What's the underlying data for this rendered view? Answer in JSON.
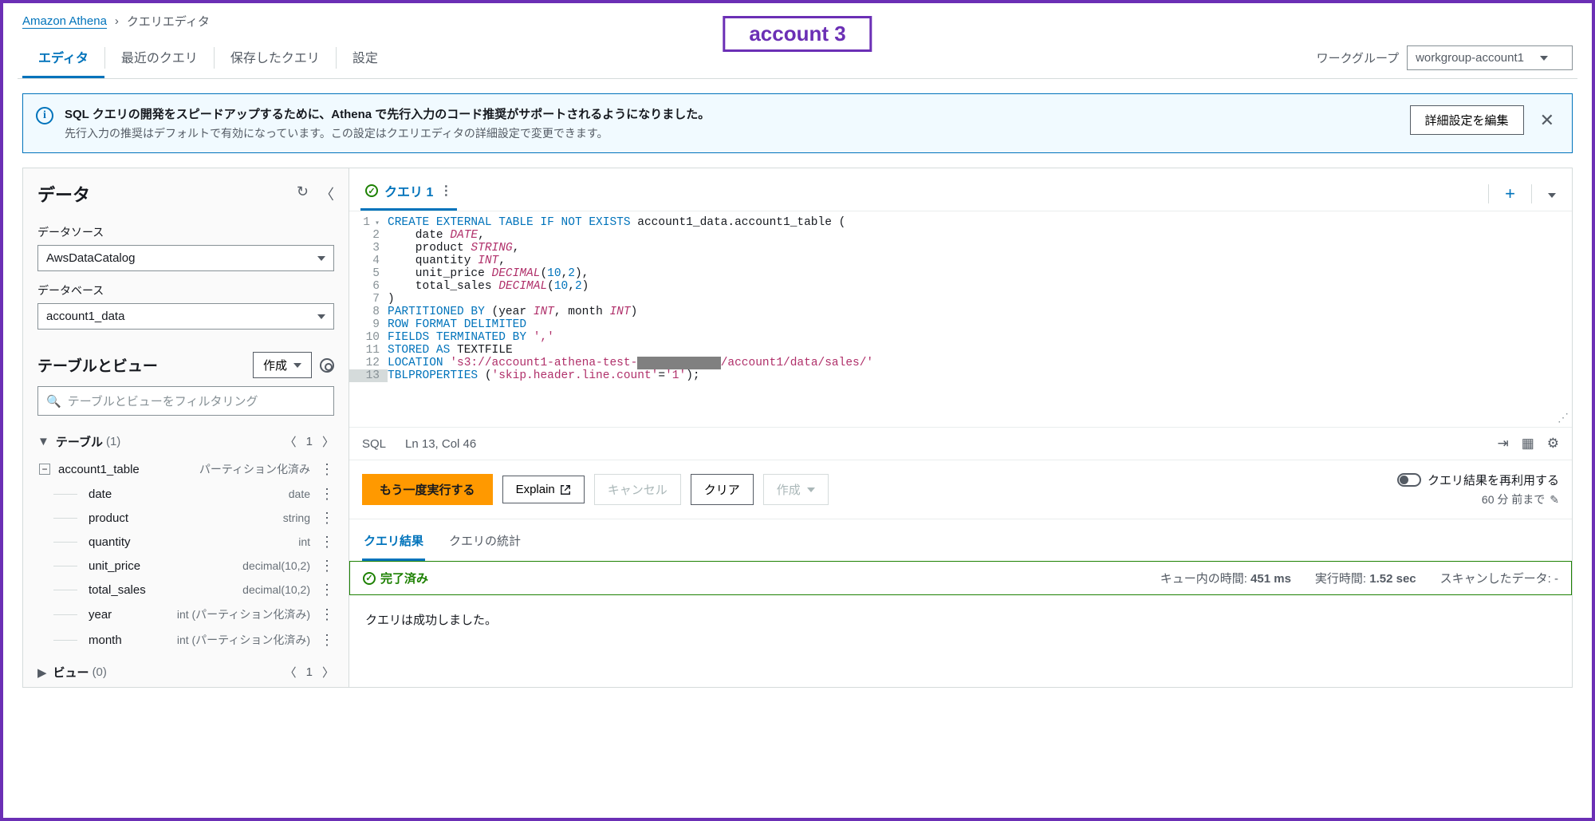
{
  "breadcrumb": {
    "service": "Amazon Athena",
    "page": "クエリエディタ"
  },
  "account_badge": "account 3",
  "tabs": {
    "editor": "エディタ",
    "recent": "最近のクエリ",
    "saved": "保存したクエリ",
    "settings": "設定"
  },
  "workgroup": {
    "label": "ワークグループ",
    "value": "workgroup-account1"
  },
  "banner": {
    "line1": "SQL クエリの開発をスピードアップするために、Athena で先行入力のコード推奨がサポートされるようになりました。",
    "line2": "先行入力の推奨はデフォルトで有効になっています。この設定はクエリエディタの詳細設定で変更できます。",
    "action": "詳細設定を編集"
  },
  "sidebar": {
    "title": "データ",
    "datasource_label": "データソース",
    "datasource_value": "AwsDataCatalog",
    "database_label": "データベース",
    "database_value": "account1_data",
    "tables_views_title": "テーブルとビュー",
    "create_btn": "作成",
    "filter_placeholder": "テーブルとビューをフィルタリング",
    "tables_label": "テーブル",
    "tables_count": "(1)",
    "table_name": "account1_table",
    "table_meta": "パーティション化済み",
    "columns": [
      {
        "name": "date",
        "type": "date"
      },
      {
        "name": "product",
        "type": "string"
      },
      {
        "name": "quantity",
        "type": "int"
      },
      {
        "name": "unit_price",
        "type": "decimal(10,2)"
      },
      {
        "name": "total_sales",
        "type": "decimal(10,2)"
      },
      {
        "name": "year",
        "type": "int (パーティション化済み)"
      },
      {
        "name": "month",
        "type": "int (パーティション化済み)"
      }
    ],
    "views_label": "ビュー",
    "views_count": "(0)",
    "page_num": "1"
  },
  "query_tab": {
    "name": "クエリ 1"
  },
  "code": {
    "lines": [
      [
        {
          "t": "CREATE EXTERNAL TABLE IF NOT EXISTS",
          "c": "kw"
        },
        {
          "t": " account1_data.account1_table ("
        }
      ],
      [
        {
          "t": "    date ",
          "c": ""
        },
        {
          "t": "DATE",
          "c": "type"
        },
        {
          "t": ","
        }
      ],
      [
        {
          "t": "    product ",
          "c": ""
        },
        {
          "t": "STRING",
          "c": "type"
        },
        {
          "t": ","
        }
      ],
      [
        {
          "t": "    quantity ",
          "c": ""
        },
        {
          "t": "INT",
          "c": "type"
        },
        {
          "t": ","
        }
      ],
      [
        {
          "t": "    unit_price ",
          "c": ""
        },
        {
          "t": "DECIMAL",
          "c": "type"
        },
        {
          "t": "("
        },
        {
          "t": "10",
          "c": "num"
        },
        {
          "t": ","
        },
        {
          "t": "2",
          "c": "num"
        },
        {
          "t": "),"
        }
      ],
      [
        {
          "t": "    total_sales ",
          "c": ""
        },
        {
          "t": "DECIMAL",
          "c": "type"
        },
        {
          "t": "("
        },
        {
          "t": "10",
          "c": "num"
        },
        {
          "t": ","
        },
        {
          "t": "2",
          "c": "num"
        },
        {
          "t": ")"
        }
      ],
      [
        {
          "t": ")"
        }
      ],
      [
        {
          "t": "PARTITIONED BY",
          "c": "kw"
        },
        {
          "t": " (year "
        },
        {
          "t": "INT",
          "c": "type"
        },
        {
          "t": ", month "
        },
        {
          "t": "INT",
          "c": "type"
        },
        {
          "t": ")"
        }
      ],
      [
        {
          "t": "ROW FORMAT DELIMITED",
          "c": "kw"
        }
      ],
      [
        {
          "t": "FIELDS TERMINATED BY",
          "c": "kw"
        },
        {
          "t": " "
        },
        {
          "t": "','",
          "c": "str"
        }
      ],
      [
        {
          "t": "STORED AS",
          "c": "kw"
        },
        {
          "t": " TEXTFILE"
        }
      ],
      [
        {
          "t": "LOCATION",
          "c": "kw"
        },
        {
          "t": " "
        },
        {
          "t": "'s3://account1-athena-test-",
          "c": "str"
        },
        {
          "t": "xxxxxxxxxxxx",
          "c": "redact"
        },
        {
          "t": "/account1/data/sales/'",
          "c": "str"
        }
      ],
      [
        {
          "t": "TBLPROPERTIES",
          "c": "kw"
        },
        {
          "t": " ("
        },
        {
          "t": "'skip.header.line.count'",
          "c": "str"
        },
        {
          "t": "="
        },
        {
          "t": "'1'",
          "c": "str"
        },
        {
          "t": ");"
        }
      ]
    ]
  },
  "status_bar": {
    "lang": "SQL",
    "pos": "Ln 13, Col 46"
  },
  "actions": {
    "run": "もう一度実行する",
    "explain": "Explain",
    "cancel": "キャンセル",
    "clear": "クリア",
    "create": "作成",
    "reuse_label": "クエリ結果を再利用する",
    "reuse_sub": "60 分 前まで"
  },
  "results": {
    "tab_results": "クエリ結果",
    "tab_stats": "クエリの統計",
    "status": "完了済み",
    "queue_label": "キュー内の時間:",
    "queue_val": "451 ms",
    "runtime_label": "実行時間:",
    "runtime_val": "1.52 sec",
    "scanned_label": "スキャンしたデータ:",
    "scanned_val": "-",
    "message": "クエリは成功しました。"
  }
}
